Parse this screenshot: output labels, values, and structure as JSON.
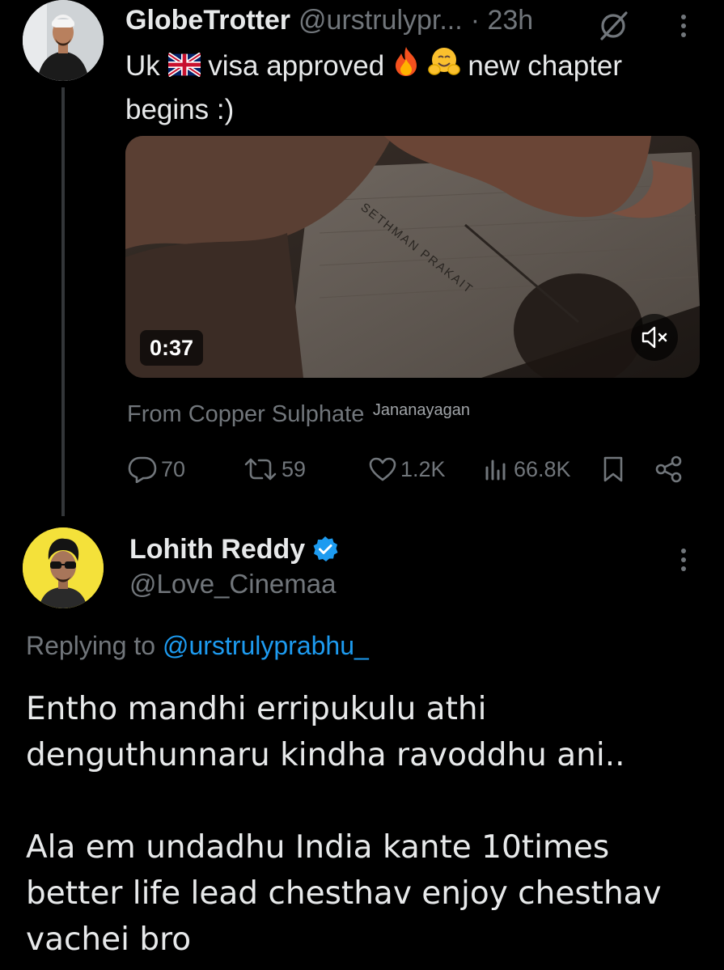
{
  "parent_tweet": {
    "display_name": "GlobeTrotter",
    "handle": "@urstrulypr...",
    "time": "· 23h",
    "text_parts": [
      "Uk",
      "visa approved",
      "new chapter begins :)"
    ],
    "text_emojis": [
      "flag-uk",
      "fire",
      "hugging-face"
    ],
    "video": {
      "duration": "0:37",
      "caption_in_video": "SETHMAN PRAKAIT",
      "sound": "muted"
    },
    "attribution": {
      "from": "From Copper Sulphate",
      "sub": "Jananayagan"
    },
    "stats": {
      "replies": "70",
      "reposts": "59",
      "likes": "1.2K",
      "views": "66.8K"
    }
  },
  "reply_tweet": {
    "display_name": "Lohith Reddy",
    "verified": true,
    "handle": "@Love_Cinemaa",
    "replying_prefix": "Replying to",
    "replying_to": "@urstrulyprabhu_",
    "paragraphs": [
      "Entho mandhi erripukulu athi denguthunnaru kindha ravoddhu ani..",
      "Ala em undadhu India kante 10times better life lead chesthav enjoy chesthav vachei bro"
    ]
  },
  "colors": {
    "background": "#000000",
    "primary_text": "#e7e9ea",
    "secondary_text": "#71767b",
    "link": "#1d9bf0",
    "verified": "#1d9bf0",
    "thread_line": "#333639"
  },
  "icons": [
    "grok-icon",
    "more-icon",
    "mute-icon",
    "reply-icon",
    "repost-icon",
    "like-icon",
    "views-icon",
    "bookmark-icon",
    "share-icon",
    "verified-badge-icon"
  ]
}
